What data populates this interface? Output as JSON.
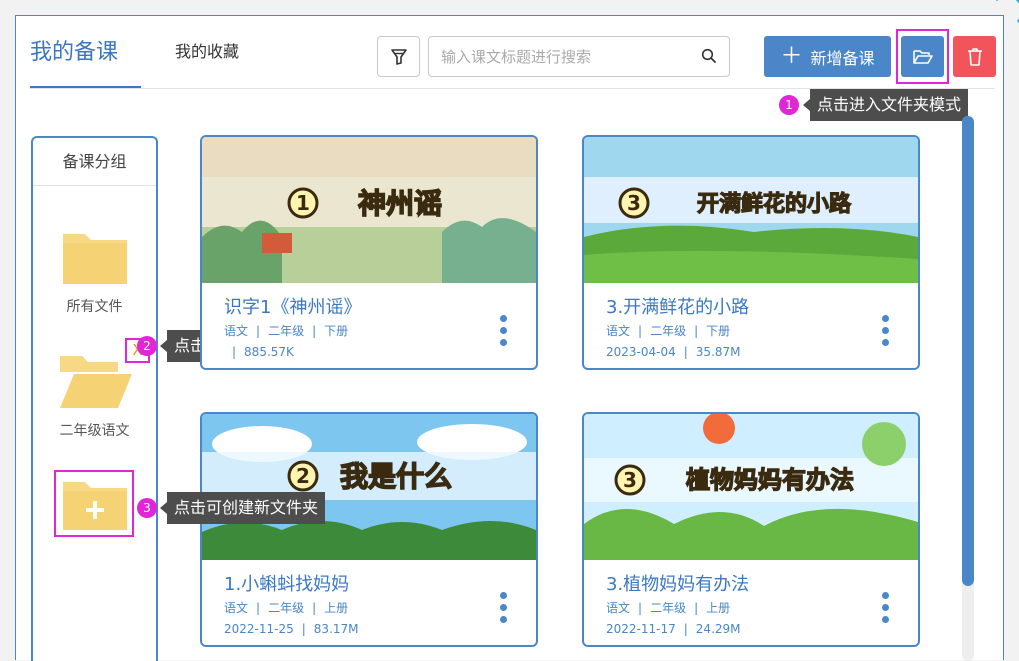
{
  "tabs": {
    "active": "我的备课",
    "inactive": "我的收藏"
  },
  "search": {
    "placeholder": "输入课文标题进行搜索",
    "value": ""
  },
  "toolbar": {
    "add_label": "新增备课",
    "add_symbol": "＋"
  },
  "tips": [
    {
      "badge": "1",
      "text": "点击进入文件夹模式"
    },
    {
      "badge": "2",
      "text": "点击可删除文件夹"
    },
    {
      "badge": "3",
      "text": "点击可创建新文件夹"
    }
  ],
  "sidebar": {
    "title": "备课分组",
    "folders": [
      {
        "label": "所有文件"
      },
      {
        "label": "二年级语文",
        "delete_mark": "X"
      },
      {
        "label": ""
      }
    ]
  },
  "cards": [
    {
      "thumb_num": "1",
      "thumb_text": "神州谣",
      "title": "识字1《神州谣》",
      "subject": "语文",
      "grade": "二年级",
      "term": "下册",
      "date": "",
      "size": "885.57K"
    },
    {
      "thumb_num": "3",
      "thumb_text": "开满鲜花的小路",
      "title": "3.开满鲜花的小路",
      "subject": "语文",
      "grade": "二年级",
      "term": "下册",
      "date": "2023-04-04",
      "size": "35.87M"
    },
    {
      "thumb_num": "2",
      "thumb_text": "我是什么",
      "title": "1.小蝌蚪找妈妈",
      "subject": "语文",
      "grade": "二年级",
      "term": "上册",
      "date": "2022-11-25",
      "size": "83.17M"
    },
    {
      "thumb_num": "3",
      "thumb_text": "植物妈妈有办法",
      "title": "3.植物妈妈有办法",
      "subject": "语文",
      "grade": "二年级",
      "term": "上册",
      "date": "2022-11-17",
      "size": "24.29M"
    }
  ],
  "colors": {
    "accent": "#4a86c8",
    "danger": "#f2545b",
    "highlight": "#e026d6",
    "folder": "#f7d985"
  },
  "icons": [
    "filter-icon",
    "search-icon",
    "plus-icon",
    "folder-open-icon",
    "trash-icon",
    "folder-icon",
    "more-vertical-icon"
  ]
}
